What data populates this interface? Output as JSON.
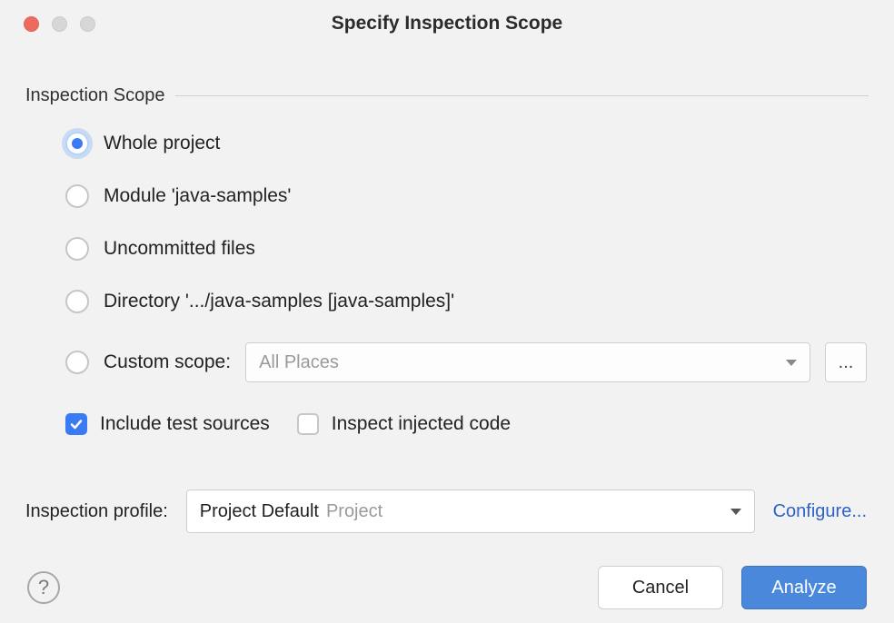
{
  "window": {
    "title": "Specify Inspection Scope"
  },
  "section": {
    "title": "Inspection Scope"
  },
  "radios": {
    "whole_project": "Whole project",
    "module": "Module 'java-samples'",
    "uncommitted": "Uncommitted files",
    "directory": "Directory '.../java-samples [java-samples]'",
    "custom_label": "Custom scope:"
  },
  "custom_scope": {
    "selected": "All Places",
    "ellipsis": "..."
  },
  "checkboxes": {
    "include_tests": "Include test sources",
    "inspect_injected": "Inspect injected code"
  },
  "profile": {
    "label": "Inspection profile:",
    "value": "Project Default",
    "sub": "Project",
    "configure": "Configure..."
  },
  "buttons": {
    "cancel": "Cancel",
    "analyze": "Analyze"
  },
  "help": {
    "label": "?"
  }
}
